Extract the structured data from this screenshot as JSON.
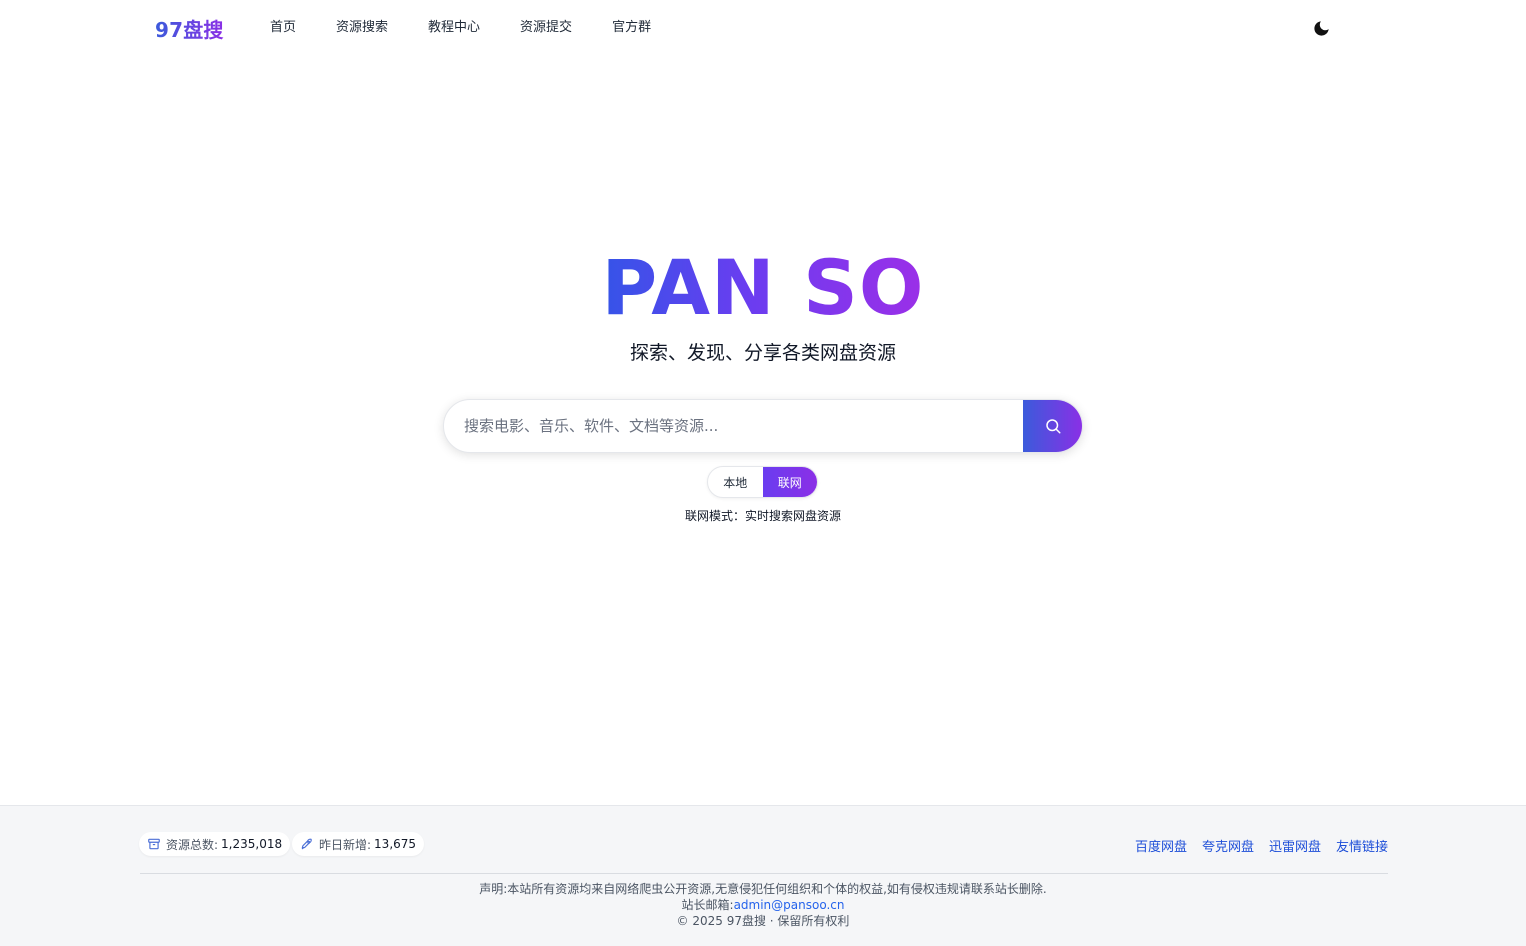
{
  "header": {
    "logo": "97盘搜",
    "nav": [
      "首页",
      "资源搜索",
      "教程中心",
      "资源提交",
      "官方群"
    ],
    "theme_icon": "moon-icon"
  },
  "hero": {
    "title": "PAN SO",
    "subtitle": "探索、发现、分享各类网盘资源"
  },
  "search": {
    "placeholder": "搜索电影、音乐、软件、文档等资源...",
    "button_icon": "search-icon"
  },
  "mode": {
    "options": [
      "本地",
      "联网"
    ],
    "active": "联网",
    "description": "联网模式：实时搜索网盘资源"
  },
  "footer": {
    "stats": [
      {
        "label": "资源总数:",
        "value": "1,235,018",
        "icon": "archive-icon"
      },
      {
        "label": "昨日新增:",
        "value": "13,675",
        "icon": "rocket-icon"
      }
    ],
    "links": [
      "百度网盘",
      "夸克网盘",
      "迅雷网盘",
      "友情链接"
    ],
    "disclaimer": "声明:本站所有资源均来自网络爬虫公开资源,无意侵犯任何组织和个体的权益,如有侵权违规请联系站长删除.",
    "email_label": "站长邮箱:",
    "email": "admin@pansoo.cn",
    "copyright": "© 2025 97盘搜 · 保留所有权利"
  },
  "colors": {
    "accent_start": "#3b5bdb",
    "accent_end": "#8b2fe6",
    "link": "#1d4ed8"
  }
}
